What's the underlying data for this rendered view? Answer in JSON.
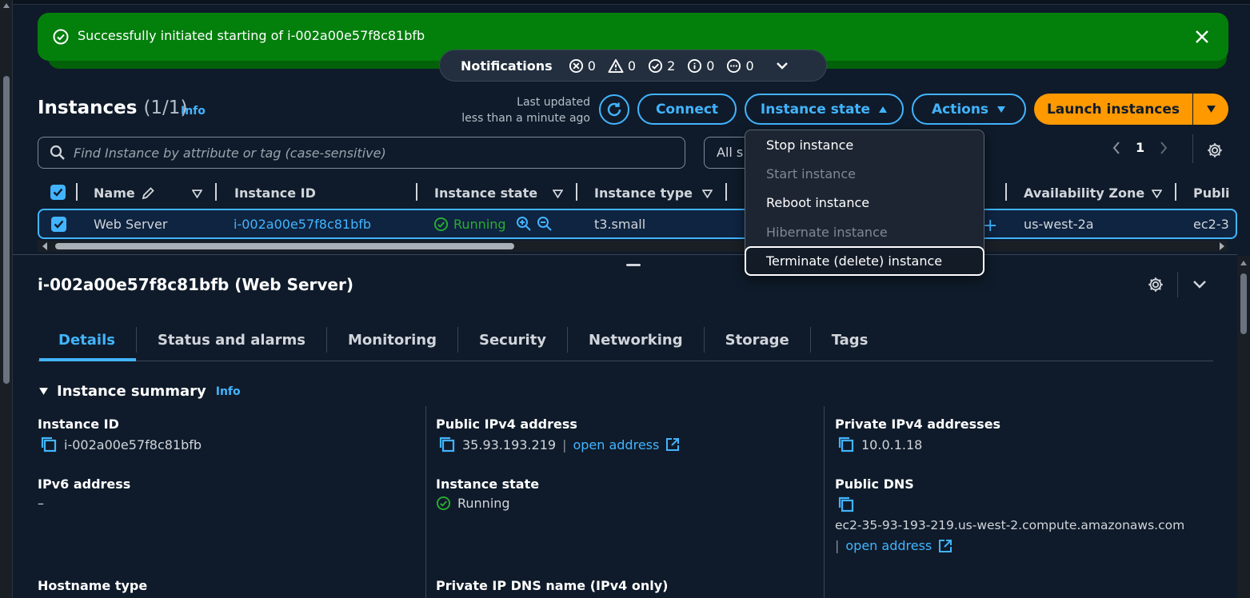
{
  "flash": {
    "message": "Successfully initiated starting of i-002a00e57f8c81bfb",
    "close_icon": "close-icon"
  },
  "notifications": {
    "title": "Notifications",
    "error": "0",
    "warning": "0",
    "success": "2",
    "info": "0",
    "in_progress": "0"
  },
  "header": {
    "title": "Instances",
    "count": "(1/1)",
    "info": "Info",
    "last_updated_1": "Last updated",
    "last_updated_2": "less than a minute ago",
    "connect": "Connect",
    "instance_state": "Instance state",
    "actions": "Actions",
    "launch": "Launch instances"
  },
  "search": {
    "placeholder": "Find Instance by attribute or tag (case-sensitive)",
    "all_select": "All s"
  },
  "pager": {
    "page": "1"
  },
  "table": {
    "columns": [
      "Name",
      "Instance ID",
      "Instance state",
      "Instance type",
      "Availability Zone",
      "Publi"
    ],
    "row": {
      "name": "Web Server",
      "instance_id": "i-002a00e57f8c81bfb",
      "state": "Running",
      "type": "t3.small",
      "az": "us-west-2a",
      "public": "ec2-3"
    }
  },
  "menu": {
    "items": [
      {
        "label": "Stop instance",
        "disabled": false
      },
      {
        "label": "Start instance",
        "disabled": true
      },
      {
        "label": "Reboot instance",
        "disabled": false
      },
      {
        "label": "Hibernate instance",
        "disabled": true
      },
      {
        "label": "Terminate (delete) instance",
        "disabled": false
      }
    ]
  },
  "details": {
    "title": "i-002a00e57f8c81bfb (Web Server)",
    "tabs": [
      "Details",
      "Status and alarms",
      "Monitoring",
      "Security",
      "Networking",
      "Storage",
      "Tags"
    ],
    "summary": "Instance summary",
    "summary_info": "Info",
    "fields": {
      "instance_id_label": "Instance ID",
      "instance_id": "i-002a00e57f8c81bfb",
      "public_ipv4_label": "Public IPv4 address",
      "public_ipv4": "35.93.193.219",
      "open_address": "open address",
      "private_ipv4_label": "Private IPv4 addresses",
      "private_ipv4": "10.0.1.18",
      "ipv6_label": "IPv6 address",
      "ipv6": "–",
      "state_label": "Instance state",
      "state": "Running",
      "public_dns_label": "Public DNS",
      "public_dns": "ec2-35-93-193-219.us-west-2.compute.amazonaws.com",
      "hostname_label": "Hostname type",
      "private_dns_label": "Private IP DNS name (IPv4 only)"
    }
  },
  "colors": {
    "accent": "#42b4ff",
    "success": "#037f0c",
    "launch": "#ff9900",
    "running": "#29ad32"
  }
}
